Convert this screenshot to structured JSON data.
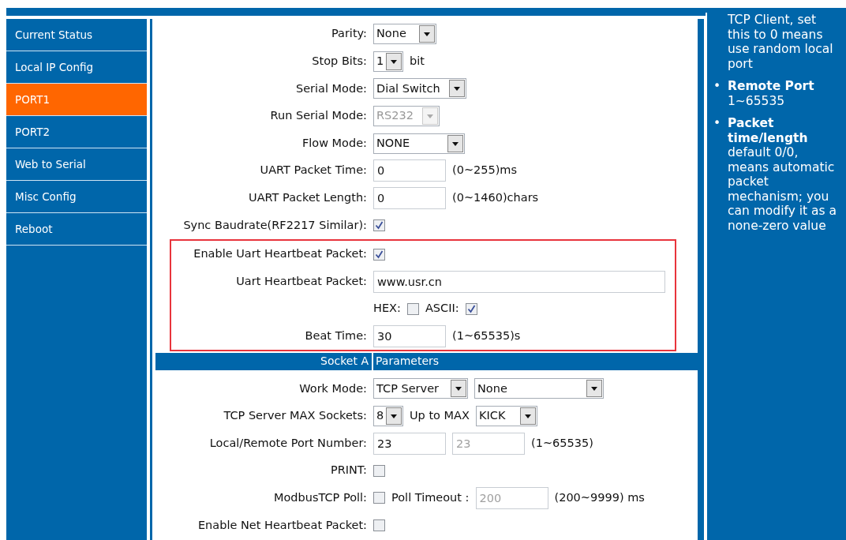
{
  "sidebar": {
    "items": [
      {
        "label": "Current Status",
        "selected": false
      },
      {
        "label": "Local IP Config",
        "selected": false
      },
      {
        "label": "PORT1",
        "selected": true
      },
      {
        "label": "PORT2",
        "selected": false
      },
      {
        "label": "Web to Serial",
        "selected": false
      },
      {
        "label": "Misc Config",
        "selected": false
      },
      {
        "label": "Reboot",
        "selected": false
      }
    ]
  },
  "form": {
    "sections": [
      {
        "rows": [
          {
            "label": "Parity:",
            "controls": [
              {
                "kind": "select",
                "value": "None",
                "disabled": false
              }
            ]
          },
          {
            "label": "Stop Bits:",
            "controls": [
              {
                "kind": "select",
                "value": "1",
                "disabled": false
              },
              {
                "kind": "text",
                "text": "bit"
              }
            ]
          },
          {
            "label": "Serial Mode:",
            "controls": [
              {
                "kind": "select",
                "value": "Dial Switch",
                "disabled": false
              }
            ]
          },
          {
            "label": "Run Serial Mode:",
            "controls": [
              {
                "kind": "select",
                "value": "RS232",
                "disabled": true
              }
            ]
          },
          {
            "label": "Flow Mode:",
            "controls": [
              {
                "kind": "select",
                "value": "NONE",
                "disabled": false
              }
            ]
          },
          {
            "label": "UART Packet Time:",
            "controls": [
              {
                "kind": "input",
                "value": "0",
                "disabled": false
              },
              {
                "kind": "text",
                "text": "(0~255)ms"
              }
            ]
          },
          {
            "label": "UART Packet Length:",
            "controls": [
              {
                "kind": "input",
                "value": "0",
                "disabled": false
              },
              {
                "kind": "text",
                "text": "(0~1460)chars"
              }
            ]
          },
          {
            "label": "Sync Baudrate(RF2217 Similar):",
            "controls": [
              {
                "kind": "checkbox",
                "checked": true
              }
            ]
          }
        ]
      },
      {
        "outlined": true,
        "rows": [
          {
            "label": "Enable Uart Heartbeat Packet:",
            "controls": [
              {
                "kind": "checkbox",
                "checked": true
              }
            ]
          },
          {
            "label": "Uart Heartbeat Packet:",
            "controls": [
              {
                "kind": "input",
                "value": "www.usr.cn",
                "disabled": false
              }
            ]
          },
          {
            "label": "",
            "controls": [
              {
                "kind": "text",
                "text": "HEX:"
              },
              {
                "kind": "checkbox",
                "checked": false
              },
              {
                "kind": "text",
                "text": "ASCII:"
              },
              {
                "kind": "checkbox",
                "checked": true
              }
            ]
          },
          {
            "label": "Beat Time:",
            "controls": [
              {
                "kind": "input",
                "value": "30",
                "disabled": false
              },
              {
                "kind": "text",
                "text": "(1~65535)s"
              }
            ]
          }
        ]
      },
      {
        "header": {
          "left": "Socket A",
          "right": "Parameters"
        },
        "rows": [
          {
            "label": "Work Mode:",
            "controls": [
              {
                "kind": "select",
                "value": "TCP Server",
                "disabled": false
              },
              {
                "kind": "select",
                "value": "None",
                "disabled": false
              }
            ]
          },
          {
            "label": "TCP Server MAX Sockets:",
            "controls": [
              {
                "kind": "select",
                "value": "8",
                "disabled": false
              },
              {
                "kind": "text",
                "text": "Up to MAX"
              },
              {
                "kind": "select",
                "value": "KICK",
                "disabled": false
              }
            ]
          },
          {
            "label": "Local/Remote Port Number:",
            "controls": [
              {
                "kind": "input",
                "value": "23",
                "disabled": false
              },
              {
                "kind": "input",
                "value": "23",
                "disabled": true
              },
              {
                "kind": "text",
                "text": "(1~65535)"
              }
            ]
          },
          {
            "label": "PRINT:",
            "controls": [
              {
                "kind": "checkbox",
                "checked": false
              }
            ]
          },
          {
            "label": "ModbusTCP Poll:",
            "controls": [
              {
                "kind": "checkbox",
                "checked": false
              },
              {
                "kind": "text",
                "text": "Poll Timeout :"
              },
              {
                "kind": "input",
                "value": "200",
                "disabled": true
              },
              {
                "kind": "text",
                "text": "(200~9999) ms"
              }
            ]
          },
          {
            "label": "Enable Net Heartbeat Packet:",
            "controls": [
              {
                "kind": "checkbox",
                "checked": false
              }
            ]
          }
        ]
      }
    ]
  },
  "help": {
    "items": [
      {
        "text": "TCP Client, set this to 0 means use random local port"
      },
      {
        "marker": "•",
        "title": "Remote Port",
        "text": "1~65535"
      },
      {
        "marker": "•",
        "title": "Packet time/length",
        "text": "default 0/0, means automatic packet mechanism; you can modify it as a none-zero value"
      }
    ]
  }
}
